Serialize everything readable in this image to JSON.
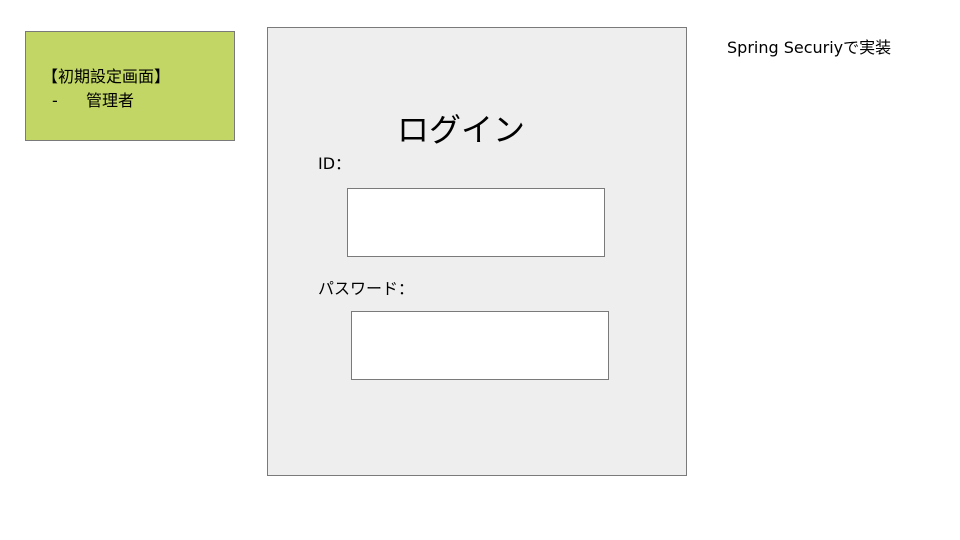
{
  "colors": {
    "note_fill": "#c2d665",
    "panel_fill": "#eeeeee",
    "border": "#7a7a7a"
  },
  "note": {
    "title": "【初期設定画面】",
    "bullet": "-",
    "item": "管理者"
  },
  "login": {
    "title": "ログイン",
    "id_label": "ID：",
    "password_label": "パスワード："
  },
  "side_note": "Spring Securiyで実装"
}
